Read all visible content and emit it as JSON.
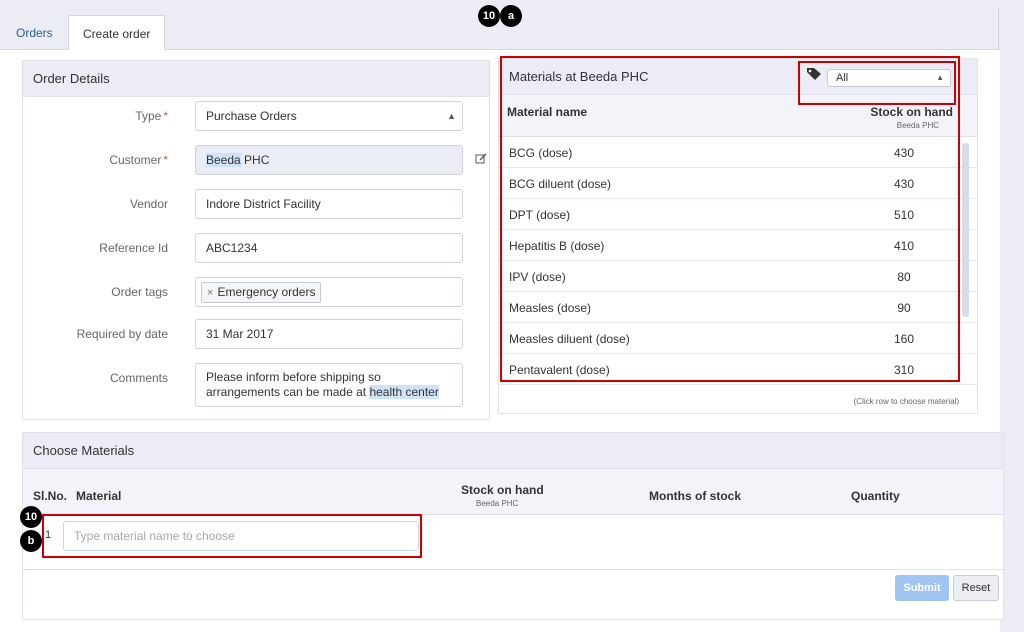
{
  "tabs": [
    {
      "label": "Orders"
    },
    {
      "label": "Create order"
    }
  ],
  "order_details": {
    "title": "Order Details",
    "fields": {
      "type": {
        "label": "Type",
        "required": "*",
        "value": "Purchase Orders"
      },
      "customer": {
        "label": "Customer",
        "required": "*",
        "value_highlight": "Beeda",
        "value_rest": " PHC"
      },
      "vendor": {
        "label": "Vendor",
        "value": "Indore District Facility"
      },
      "reference": {
        "label": "Reference Id",
        "value": "ABC1234"
      },
      "tags": {
        "label": "Order tags",
        "chip_remove": "×",
        "chip": "Emergency orders"
      },
      "required_by": {
        "label": "Required by date",
        "value": "31 Mar 2017"
      },
      "comments": {
        "label": "Comments",
        "line1": "Please inform before shipping so",
        "line2_pre": "arrangements can be made at ",
        "line2_hl": "health center"
      }
    }
  },
  "materials_at": {
    "title": "Materials at Beeda PHC",
    "filter_value": "All",
    "col_name": "Material name",
    "col_stock": "Stock on hand",
    "col_stock_sub": "Beeda PHC",
    "rows": [
      {
        "name": "BCG (dose)",
        "stock": "430"
      },
      {
        "name": "BCG diluent (dose)",
        "stock": "430"
      },
      {
        "name": "DPT (dose)",
        "stock": "510"
      },
      {
        "name": "Hepatitis B (dose)",
        "stock": "410"
      },
      {
        "name": "IPV (dose)",
        "stock": "80"
      },
      {
        "name": "Measles (dose)",
        "stock": "90"
      },
      {
        "name": "Measles diluent (dose)",
        "stock": "160"
      },
      {
        "name": "Pentavalent (dose)",
        "stock": "310"
      }
    ],
    "hint": "(Click row to choose material)"
  },
  "choose_materials": {
    "title": "Choose Materials",
    "col_slno": "Sl.No.",
    "col_material": "Material",
    "col_stock": "Stock on hand",
    "col_stock_sub": "Beeda PHC",
    "col_months": "Months of stock",
    "col_quantity": "Quantity",
    "row_no": "1",
    "input_placeholder": "Type material name to choose",
    "submit": "Submit",
    "reset": "Reset"
  },
  "annotations": {
    "badge_top_num": "10",
    "badge_top_letter": "a",
    "badge_bottom_num": "10",
    "badge_bottom_letter": "b",
    "box_color": "#cc0000"
  },
  "icons": {
    "edit": "edit-icon",
    "tag": "tag-icon",
    "select_arrow": "select-arrow-icon"
  }
}
